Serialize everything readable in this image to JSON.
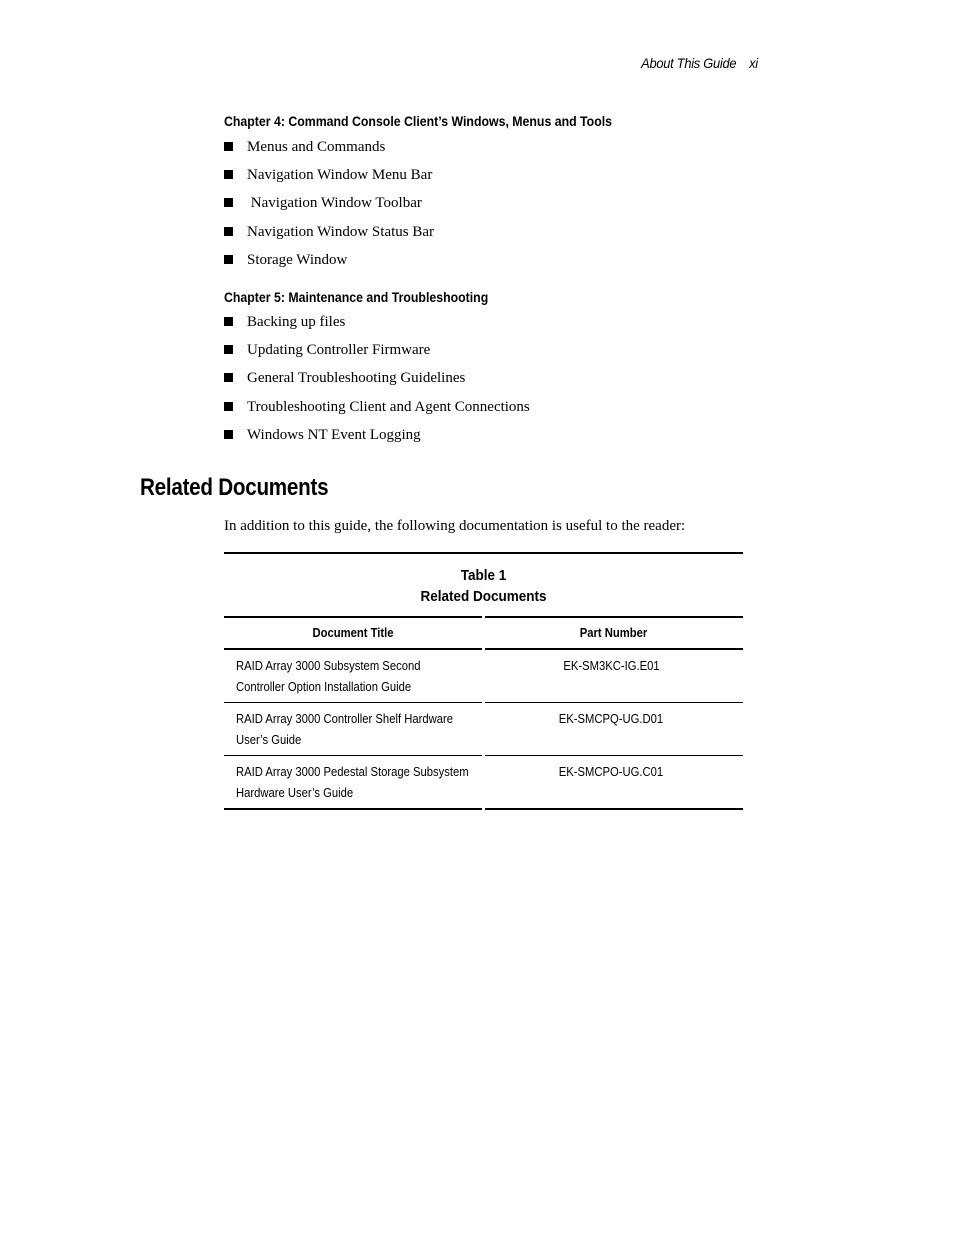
{
  "running_header": {
    "title": "About This Guide",
    "page": "xi"
  },
  "chapters": [
    {
      "heading": "Chapter 4: Command Console Client’s Windows, Menus and Tools",
      "items": [
        "Menus and Commands",
        "Navigation Window Menu Bar",
        " Navigation Window Toolbar",
        "Navigation Window Status Bar",
        "Storage Window"
      ]
    },
    {
      "heading": "Chapter 5: Maintenance and Troubleshooting",
      "items": [
        "Backing up files",
        "Updating Controller Firmware",
        "General Troubleshooting Guidelines",
        "Troubleshooting Client and Agent Connections",
        "Windows NT Event Logging"
      ]
    }
  ],
  "related": {
    "heading": "Related Documents",
    "intro": "In addition to this guide, the following documentation is useful to the reader:",
    "table": {
      "caption_line1": "Table 1",
      "caption_line2": "Related Documents",
      "columns": [
        "Document Title",
        "Part Number"
      ],
      "rows": [
        {
          "title_line1": "RAID Array 3000 Subsystem Second",
          "title_line2": "Controller Option Installation Guide",
          "part": "EK-SM3KC-IG.E01"
        },
        {
          "title_line1": "RAID Array 3000 Controller Shelf Hardware",
          "title_line2": "User’s Guide",
          "part": "EK-SMCPQ-UG.D01"
        },
        {
          "title_line1": "RAID Array 3000 Pedestal Storage Subsystem",
          "title_line2": "Hardware User’s Guide",
          "part": "EK-SMCPO-UG.C01"
        }
      ]
    }
  }
}
